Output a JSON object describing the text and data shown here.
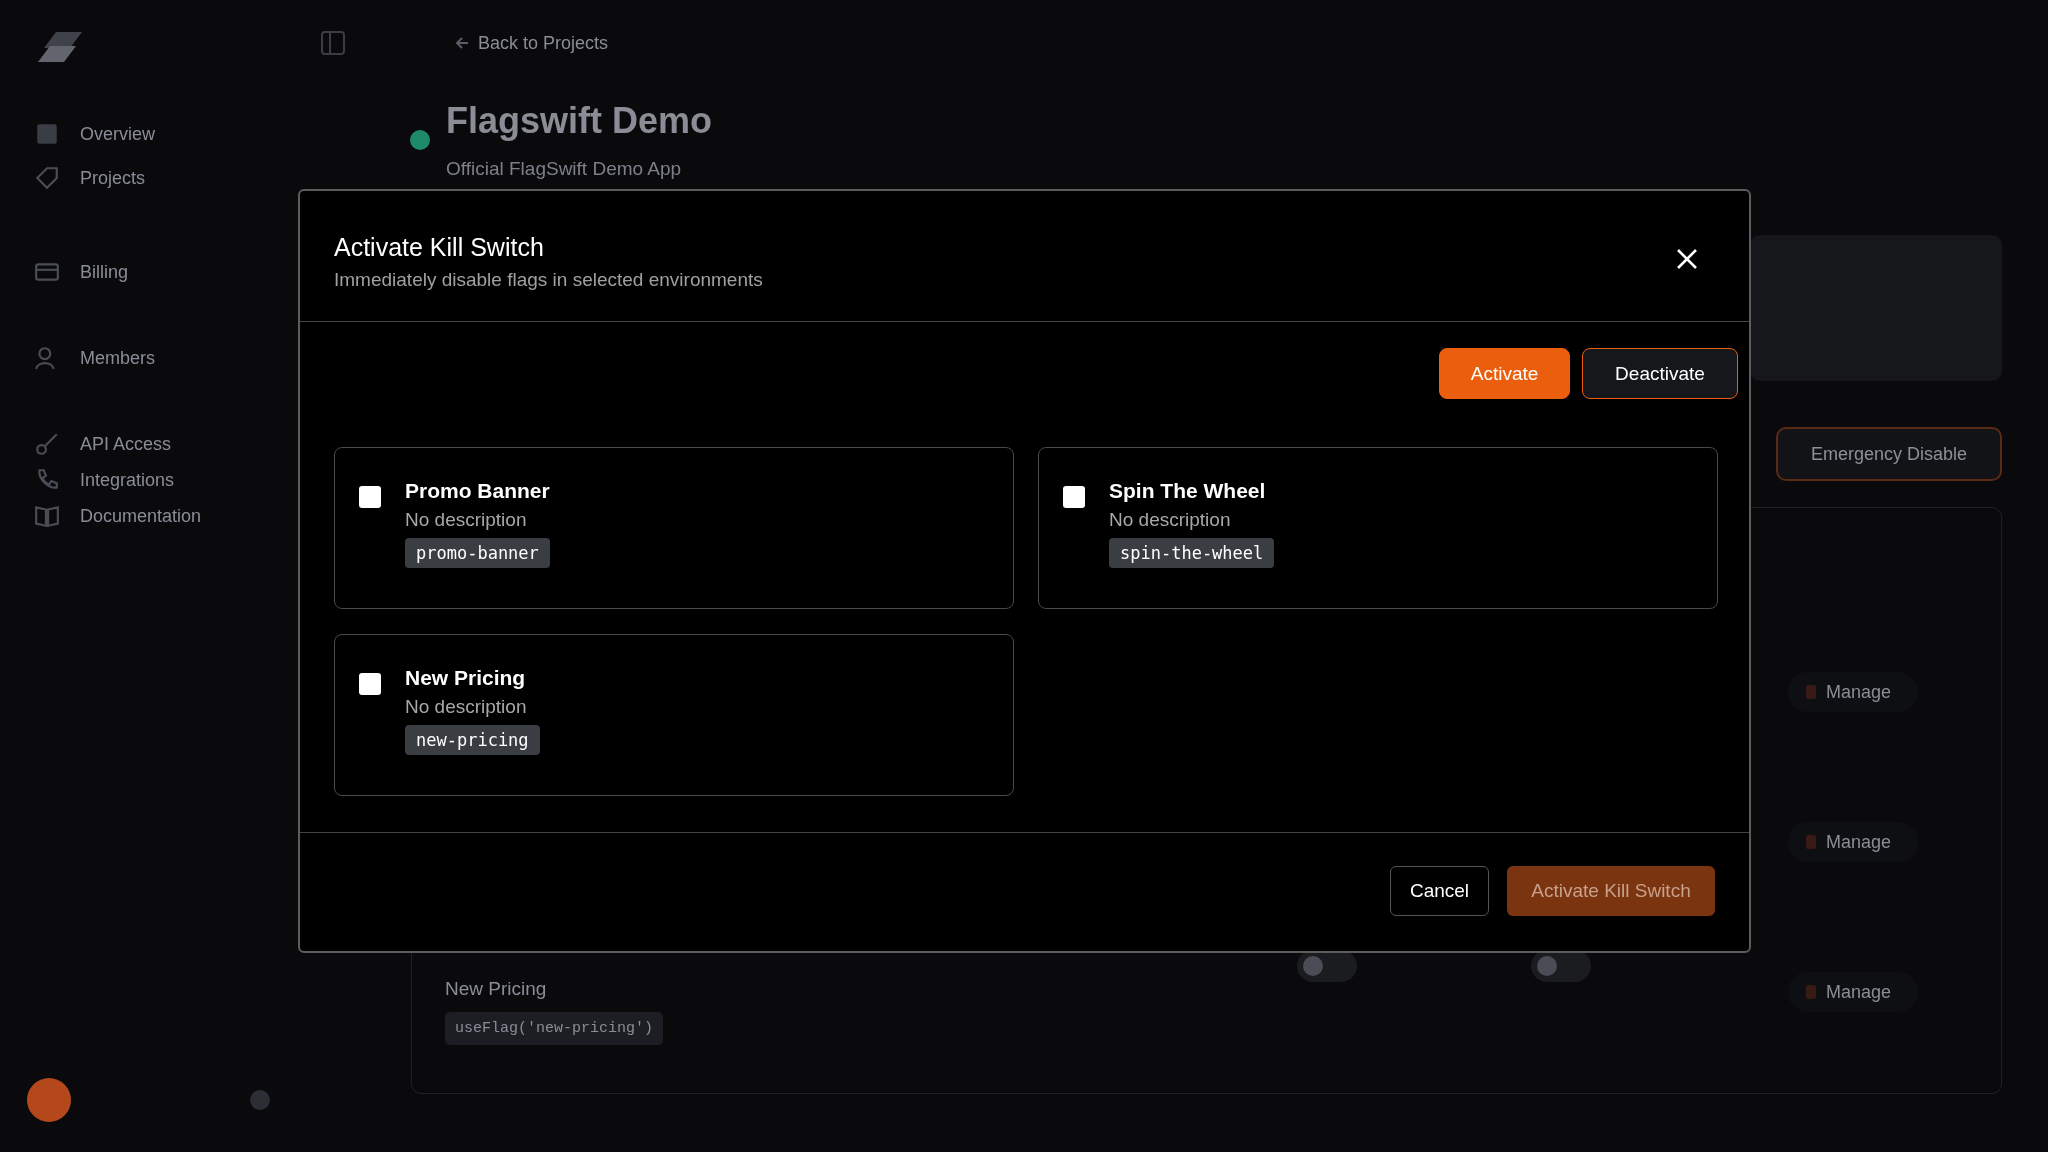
{
  "sidebar": {
    "items": [
      {
        "label": "Overview"
      },
      {
        "label": "Projects"
      },
      {
        "label": "Billing"
      },
      {
        "label": "Members"
      },
      {
        "label": "API Access"
      },
      {
        "label": "Integrations"
      },
      {
        "label": "Documentation"
      }
    ]
  },
  "page": {
    "back_link": "Back to Projects",
    "project_title": "Flagswift Demo",
    "project_subtitle": "Official FlagSwift Demo App",
    "emergency_button": "Emergency Disable",
    "rows": [
      {
        "action": "Manage"
      },
      {
        "action": "Manage"
      },
      {
        "name": "New Pricing",
        "code": "useFlag('new-pricing')",
        "toggles": [
          {
            "on": false
          },
          {
            "on": false
          }
        ],
        "action": "Manage"
      }
    ]
  },
  "dialog": {
    "title": "Activate Kill Switch",
    "subtitle": "Immediately disable flags in selected environments",
    "mode_buttons": [
      {
        "label": "Activate",
        "selected": true
      },
      {
        "label": "Deactivate",
        "selected": false
      }
    ],
    "flags": [
      {
        "name": "Promo Banner",
        "description": "No description",
        "key": "promo-banner",
        "checked": false
      },
      {
        "name": "Spin The Wheel",
        "description": "No description",
        "key": "spin-the-wheel",
        "checked": false
      },
      {
        "name": "New Pricing",
        "description": "No description",
        "key": "new-pricing",
        "checked": false
      }
    ],
    "footer_buttons": [
      {
        "label": "Cancel",
        "kind": "secondary",
        "disabled": false
      },
      {
        "label": "Activate Kill Switch",
        "kind": "primary",
        "disabled": true
      }
    ]
  }
}
